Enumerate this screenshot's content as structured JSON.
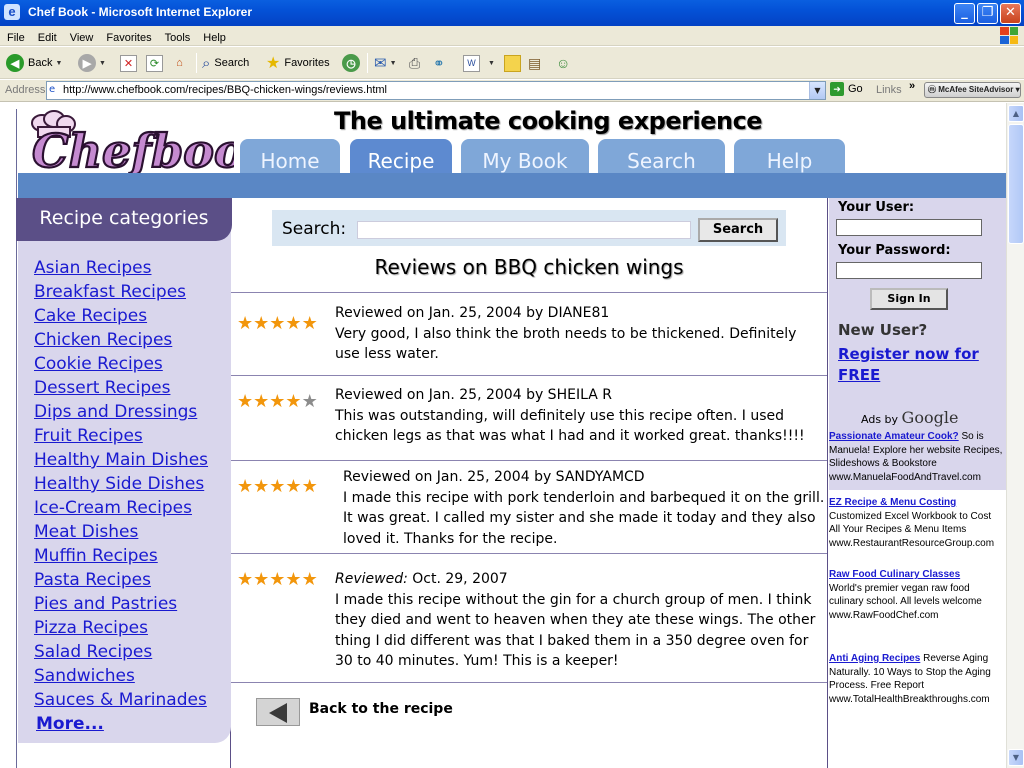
{
  "window": {
    "title": "Chef Book - Microsoft Internet Explorer",
    "controls": [
      "_",
      "❐",
      "✕"
    ]
  },
  "menubar": [
    "File",
    "Edit",
    "View",
    "Favorites",
    "Tools",
    "Help"
  ],
  "toolbar": {
    "back_label": "Back",
    "search_label": "Search",
    "favorites_label": "Favorites"
  },
  "addressbar": {
    "label": "Address",
    "url": "http://www.chefbook.com/recipes/BBQ-chicken-wings/reviews.html",
    "go_label": "Go",
    "links_label": "Links",
    "mcafee_label": "McAfee SiteAdvisor"
  },
  "header": {
    "logo_text": "Chefbook",
    "tagline": "The ultimate cooking experience",
    "tabs": [
      {
        "label": "Home"
      },
      {
        "label": "Recipe"
      },
      {
        "label": "My  Book"
      },
      {
        "label": "Search"
      },
      {
        "label": "Help"
      }
    ],
    "active_tab": "Recipe"
  },
  "sidebar": {
    "title": "Recipe categories",
    "categories": [
      "Asian Recipes",
      "Breakfast Recipes",
      "Cake Recipes",
      "Chicken Recipes",
      "Cookie Recipes",
      "Dessert Recipes",
      "Dips and Dressings",
      "Fruit Recipes",
      "Healthy Main Dishes",
      "Healthy Side Dishes",
      "Ice-Cream Recipes",
      "Meat Dishes",
      "Muffin Recipes",
      "Pasta Recipes",
      "Pies and Pastries",
      "Pizza Recipes",
      "Salad Recipes",
      "Sandwiches",
      "Sauces & Marinades"
    ],
    "more_label": "More..."
  },
  "search": {
    "label": "Search:",
    "value": "",
    "button_label": "Search"
  },
  "reviews": {
    "title": "Reviews on BBQ chicken wings",
    "items": [
      {
        "rating": 5,
        "head": "Reviewed on Jan. 25, 2004 by DIANE81",
        "body": " Very good, I also think the broth needs to be thickened. Definitely use less water."
      },
      {
        "rating": 4,
        "head": "Reviewed on Jan. 25, 2004 by SHEILA R",
        "body": "This was outstanding, will definitely use this recipe often. I used chicken legs as that was what I had and it worked great. thanks!!!!"
      },
      {
        "rating": 5,
        "head": "Reviewed on Jan. 25, 2004 by SANDYAMCD",
        "body": " I made this recipe with pork tenderloin and barbequed it on the grill. It was great. I called my sister and she made it today and they also loved it. Thanks for the recipe."
      },
      {
        "rating": 5,
        "head_italic": "Reviewed:",
        "head": " Oct. 29, 2007",
        "body": " I made this recipe without the gin for a church group of men. I think they died and went to heaven when they ate these wings. The other thing I did different was that I baked them in a 350 degree oven for 30 to 40 minutes. Yum! This is a keeper!"
      }
    ],
    "back_label": "Back to the recipe"
  },
  "login": {
    "user_label": "Your  User:",
    "user_value": "",
    "password_label": "Your Password:",
    "password_value": "",
    "signin_label": "Sign In",
    "new_user_label": "New User?",
    "register_label": "Register now for FREE"
  },
  "ads": {
    "ads_by": "Ads by",
    "google": "Google",
    "items": [
      {
        "title": "Passionate Amateur Cook?",
        "text": " So is Manuela! Explore her website Recipes, Slideshows & Bookstore",
        "url": "www.ManuelaFoodAndTravel.com"
      },
      {
        "title": "EZ Recipe & Menu Costing",
        "text": "Customized Excel Workbook to Cost All Your Recipes & Menu Items",
        "url": "www.RestaurantResourceGroup.com"
      },
      {
        "title": "Raw Food Culinary Classes",
        "text": "World's premier vegan raw food culinary school. All levels welcome",
        "url": "www.RawFoodChef.com"
      },
      {
        "title": "Anti Aging Recipes",
        "text": " Reverse Aging Naturally. 10 Ways to Stop the Aging Process. Free Report",
        "url": "www.TotalHealthBreakthroughs.com"
      }
    ]
  },
  "colors": {
    "nav_tab": "#7fa7d8",
    "nav_tab_active": "#5d8ad0",
    "nav_strip": "#5a87c5",
    "sidebar_header": "#5b4f87",
    "sidebar_bg": "#d9d6ec",
    "link": "#1a1ad0",
    "star_on": "#f2960c",
    "star_off": "#8c8c8c"
  }
}
